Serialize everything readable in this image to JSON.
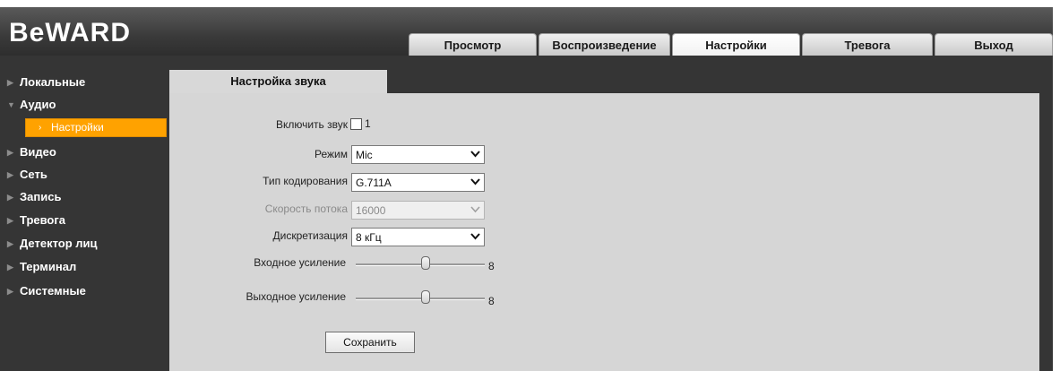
{
  "app": {
    "logo": "BeWARD"
  },
  "header": {
    "tabs": [
      {
        "label": "Просмотр",
        "active": false
      },
      {
        "label": "Воспроизведение",
        "active": false
      },
      {
        "label": "Настройки",
        "active": true
      },
      {
        "label": "Тревога",
        "active": false
      },
      {
        "label": "Выход",
        "active": false
      }
    ]
  },
  "sidebar": {
    "items": [
      {
        "label": "Локальные",
        "icon": "triangle-right-icon"
      },
      {
        "label": "Аудио",
        "icon": "triangle-down-icon"
      },
      {
        "label": "Видео",
        "icon": "triangle-right-icon"
      },
      {
        "label": "Сеть",
        "icon": "triangle-right-icon"
      },
      {
        "label": "Запись",
        "icon": "triangle-right-icon"
      },
      {
        "label": "Тревога",
        "icon": "triangle-right-icon"
      },
      {
        "label": "Детектор лиц",
        "icon": "triangle-right-icon"
      },
      {
        "label": "Терминал",
        "icon": "triangle-right-icon"
      },
      {
        "label": "Системные",
        "icon": "triangle-right-icon"
      }
    ],
    "subitem": {
      "label": "Настройки",
      "icon": "chevron-right-icon"
    }
  },
  "content": {
    "section_title": "Настройка звука",
    "enable_audio": {
      "label": "Включить звук",
      "checked": false,
      "note": "1"
    },
    "mode": {
      "label": "Режим",
      "value": "Mic"
    },
    "encoding": {
      "label": "Тип кодирования",
      "value": "G.711A"
    },
    "bitrate": {
      "label": "Скорость потока",
      "value": "16000",
      "disabled": true
    },
    "sampling": {
      "label": "Дискретизация",
      "value": "8 кГц"
    },
    "input_gain": {
      "label": "Входное усиление",
      "value": "8"
    },
    "output_gain": {
      "label": "Выходное усиление",
      "value": "8"
    },
    "save_label": "Сохранить"
  },
  "colors": {
    "accent": "#ffa200",
    "sidebar_bg": "#353535",
    "content_bg": "#d6d6d6"
  }
}
